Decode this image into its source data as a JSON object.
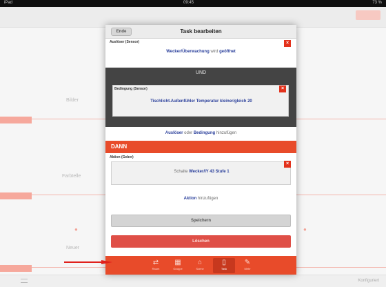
{
  "statusbar": {
    "left": "iPad",
    "time": "09:45",
    "right": "73 %"
  },
  "background": {
    "rows": [
      {
        "label": "Bilder"
      },
      {
        "label": "Farbtelle"
      },
      {
        "label": "Neuer"
      }
    ],
    "footer": "Konfiguriert"
  },
  "modal": {
    "header": {
      "back_label": "Ende",
      "title": "Task bearbeiten"
    },
    "trigger": {
      "section_label": "Auslöser (Sensor)",
      "line": {
        "a": "Wecker/Überwachung",
        "b": "wird",
        "c": "geöffnet"
      }
    },
    "and_group": {
      "label": "UND",
      "condition": {
        "section_label": "Bedingung (Sensor)",
        "line": {
          "a": "Tischlicht.Außenfühler Temperatur",
          "b": "kleiner/gleich",
          "c": "20"
        }
      }
    },
    "add_line": {
      "a": "Auslöser",
      "b": "oder",
      "c": "Bedingung",
      "d": "hinzufügen"
    },
    "then_label": "DANN",
    "action": {
      "section_label": "Aktion (Geber)",
      "line": {
        "a": "Schalte",
        "b": "Wecker/IY 43",
        "c": "Stufe 1"
      }
    },
    "add_action": {
      "a": "Aktion",
      "b": "hinzufügen"
    },
    "save_label": "Speichern",
    "delete_label": "Löschen",
    "delete_icon": "×",
    "tabs": [
      {
        "icon": "⇄",
        "label": "Raum"
      },
      {
        "icon": "▦",
        "label": "Gruppe"
      },
      {
        "icon": "⌂",
        "label": "Szene"
      },
      {
        "icon": "▯",
        "label": "Task"
      },
      {
        "icon": "✎",
        "label": "Mehr"
      }
    ]
  },
  "colors": {
    "accent": "#e84b2a",
    "delete_red": "#df4f47",
    "dark_band": "#444444",
    "link_blue": "#2a3f9b",
    "arrow_red": "#e0201c"
  }
}
